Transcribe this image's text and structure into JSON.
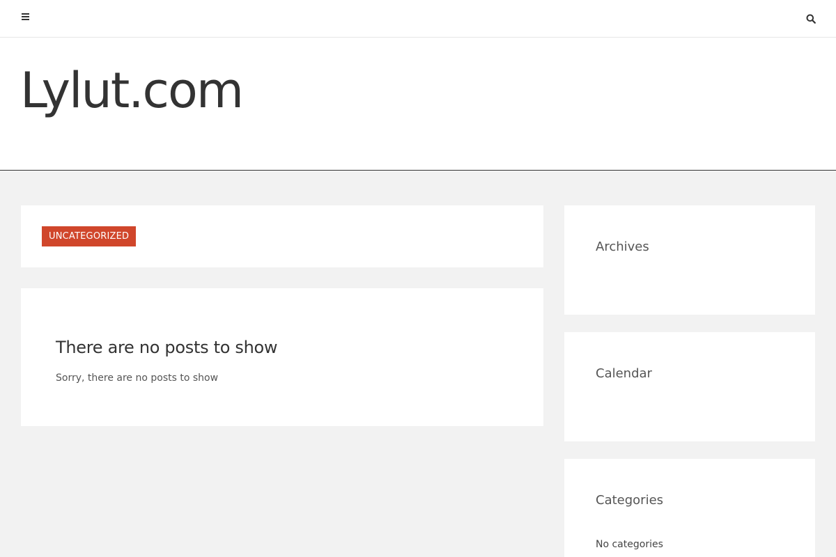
{
  "topbar": {
    "menu_icon": "hamburger-menu-icon",
    "search_icon": "search-icon"
  },
  "header": {
    "site_title": "Lylut.com"
  },
  "category": {
    "badge_label": "UNCATEGORIZED",
    "badge_color": "#d0462b"
  },
  "posts": {
    "title": "There are no posts to show",
    "message": "Sorry, there are no posts to show"
  },
  "sidebar": {
    "archives_title": "Archives",
    "calendar_title": "Calendar",
    "categories_title": "Categories",
    "categories_empty": "No categories"
  }
}
